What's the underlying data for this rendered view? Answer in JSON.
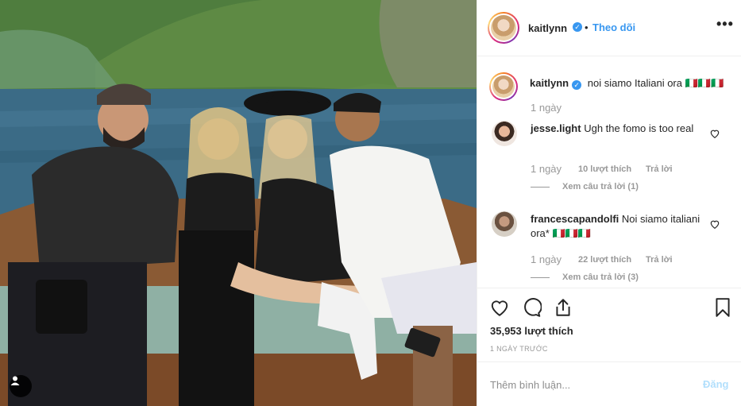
{
  "header": {
    "username": "kaitlynn",
    "separator": "•",
    "follow_label": "Theo dõi",
    "more_label": "•••"
  },
  "caption": {
    "username": "kaitlynn",
    "text": "noi siamo Italiani ora 🇮🇹🇮🇹🇮🇹",
    "time": "1 ngày"
  },
  "comments": [
    {
      "username": "jesse.light",
      "text": "Ugh the fomo is too real",
      "time": "1 ngày",
      "likes": "10 lượt thích",
      "reply_label": "Trả lời",
      "view_replies": "Xem câu trả lời (1)"
    },
    {
      "username": "francescapandolfi",
      "text": "Noi siamo italiani ora* 🇮🇹🇮🇹🇮🇹",
      "time": "1 ngày",
      "likes": "22 lượt thích",
      "reply_label": "Trả lời",
      "view_replies": "Xem câu trả lời (3)"
    }
  ],
  "post": {
    "likes_count": "35,953 lượt thích",
    "date": "1 NGÀY TRƯỚC"
  },
  "add_comment": {
    "placeholder": "Thêm bình luận...",
    "post_label": "Đăng"
  },
  "icons": [
    "user-tag-icon",
    "verified-icon",
    "more-icon",
    "heart-icon",
    "comment-icon",
    "share-icon",
    "bookmark-icon"
  ],
  "colors": {
    "link_blue": "#3897f0",
    "muted": "#999999",
    "post_disabled": "#b2dffc"
  }
}
